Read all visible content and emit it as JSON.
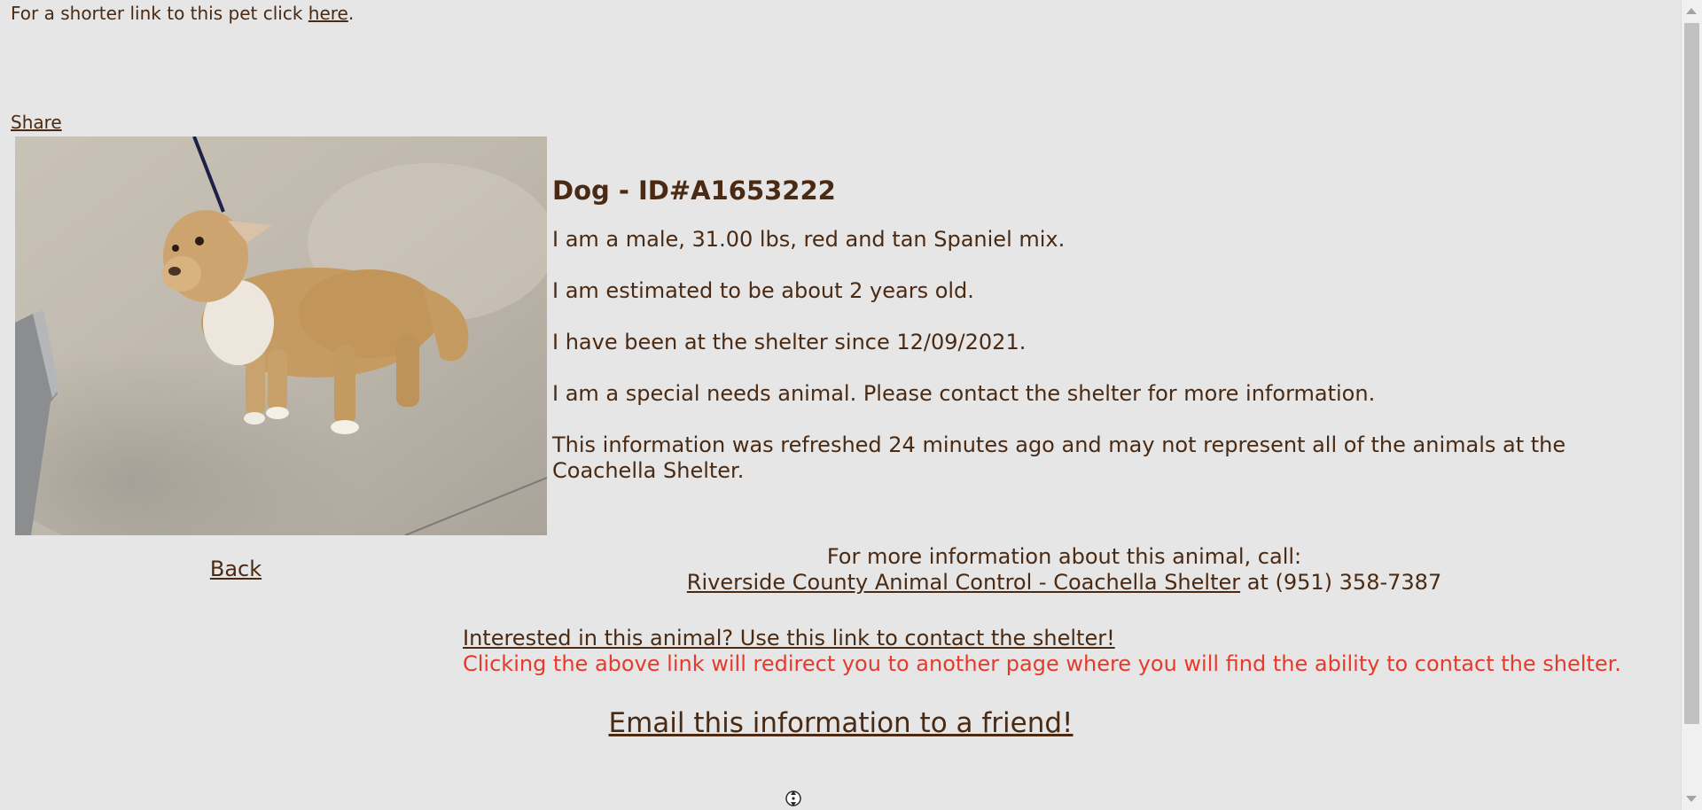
{
  "short_link": {
    "prefix": "For a shorter link to this pet click ",
    "link_text": "here",
    "suffix": "."
  },
  "share_label": "Share",
  "animal": {
    "heading": "Dog - ID#A1653222",
    "description": "I am a male, 31.00 lbs, red and tan Spaniel mix.",
    "age": "I am estimated to be about 2 years old.",
    "since": "I have been at the shelter since 12/09/2021.",
    "special_needs": "I am a special needs animal. Please contact the shelter for more information.",
    "refresh_note": "This information was refreshed 24 minutes ago and may not represent all of the animals at the Coachella Shelter."
  },
  "back_label": "Back",
  "call": {
    "intro": "For more information about this animal, call:",
    "shelter_link": "Riverside County Animal Control - Coachella Shelter",
    "at": " at ",
    "phone": "(951) 358-7387"
  },
  "interest": {
    "link_text": "Interested in this animal? Use this link to contact the shelter!",
    "note": "Clicking the above link will redirect you to another page where you will find the ability to contact the shelter."
  },
  "email_label": "Email this information to a friend!",
  "colors": {
    "background": "#e6e6e6",
    "text": "#4a2a12",
    "note_red": "#e53a2c"
  },
  "icons": {
    "photo": "dog-photo",
    "autoscroll": "autoscroll-icon"
  }
}
